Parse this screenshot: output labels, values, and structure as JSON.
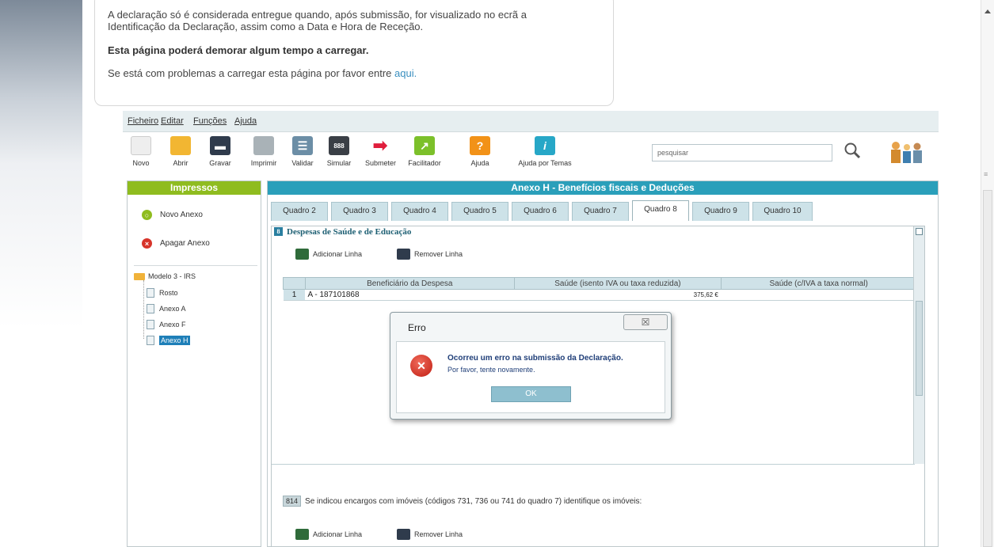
{
  "notice": {
    "line1": "A declaração só é considerada entregue quando, após submissão, for visualizado no ecrã a",
    "line2": "Identificação da Declaração, assim como a Data e Hora de Receção.",
    "warning": "Esta página poderá demorar algum tempo a carregar.",
    "help_prefix": "Se está com problemas a carregar esta página por favor entre ",
    "help_link": "aqui."
  },
  "menu": [
    "Ficheiro",
    "Editar",
    "Funções",
    "Ajuda"
  ],
  "toolbar": {
    "buttons": [
      {
        "label": "Novo",
        "icon": "new-file-icon",
        "color": "#e8e8e8"
      },
      {
        "label": "Abrir",
        "icon": "folder-open-icon",
        "color": "#f2b632"
      },
      {
        "label": "Gravar",
        "icon": "save-icon",
        "color": "#2f3b4c"
      },
      {
        "label": "Imprimir",
        "icon": "print-icon",
        "color": "#a9b2b7"
      },
      {
        "label": "Validar",
        "icon": "validate-icon",
        "color": "#6c8ea6"
      },
      {
        "label": "Simular",
        "icon": "calculator-icon",
        "color": "#3a3f46"
      },
      {
        "label": "Submeter",
        "icon": "submit-arrow-icon",
        "color": "#e01e3c"
      },
      {
        "label": "Facilitador",
        "icon": "facilitator-icon",
        "color": "#7cc02a"
      },
      {
        "label": "Ajuda",
        "icon": "help-icon",
        "color": "#f29218"
      },
      {
        "label": "Ajuda por Temas",
        "icon": "info-icon",
        "color": "#27a7c7"
      }
    ],
    "search_placeholder": "pesquisar"
  },
  "sidebar": {
    "title": "Impressos",
    "new_annex": "Novo Anexo",
    "delete_annex": "Apagar Anexo",
    "tree_root": "Modelo 3 - IRS",
    "tree_items": [
      "Rosto",
      "Anexo A",
      "Anexo F",
      "Anexo H"
    ],
    "selected": "Anexo H"
  },
  "main": {
    "title": "Anexo H - Benefícios fiscais e Deduções",
    "tabs": [
      "Quadro 2",
      "Quadro 3",
      "Quadro 4",
      "Quadro 5",
      "Quadro 6",
      "Quadro 7",
      "Quadro 8",
      "Quadro 9",
      "Quadro 10"
    ],
    "active_tab": "Quadro 8",
    "section_number": "8",
    "section_title": "Despesas de Saúde e de Educação",
    "add_row": "Adicionar Linha",
    "remove_row": "Remover Linha",
    "table": {
      "headers": [
        "Beneficiário da Despesa",
        "Saúde (isento IVA ou taxa reduzida)",
        "Saúde (c/IVA a taxa normal)"
      ],
      "rows": [
        {
          "num": "1",
          "beneficiary": "A - 187101868",
          "health_exempt": "375,62 €",
          "health_normal": ""
        }
      ]
    },
    "q14_badge": "814",
    "q14_text": "Se indicou encargos com imóveis (códigos 731, 736 ou 741 do quadro 7) identifique os imóveis:",
    "add_row_2": "Adicionar Linha",
    "remove_row_2": "Remover Linha"
  },
  "dialog": {
    "title": "Erro",
    "close": "☒",
    "message": "Ocorreu um erro na submissão da Declaração.",
    "sub": "Por favor, tente novamente.",
    "ok": "OK"
  }
}
